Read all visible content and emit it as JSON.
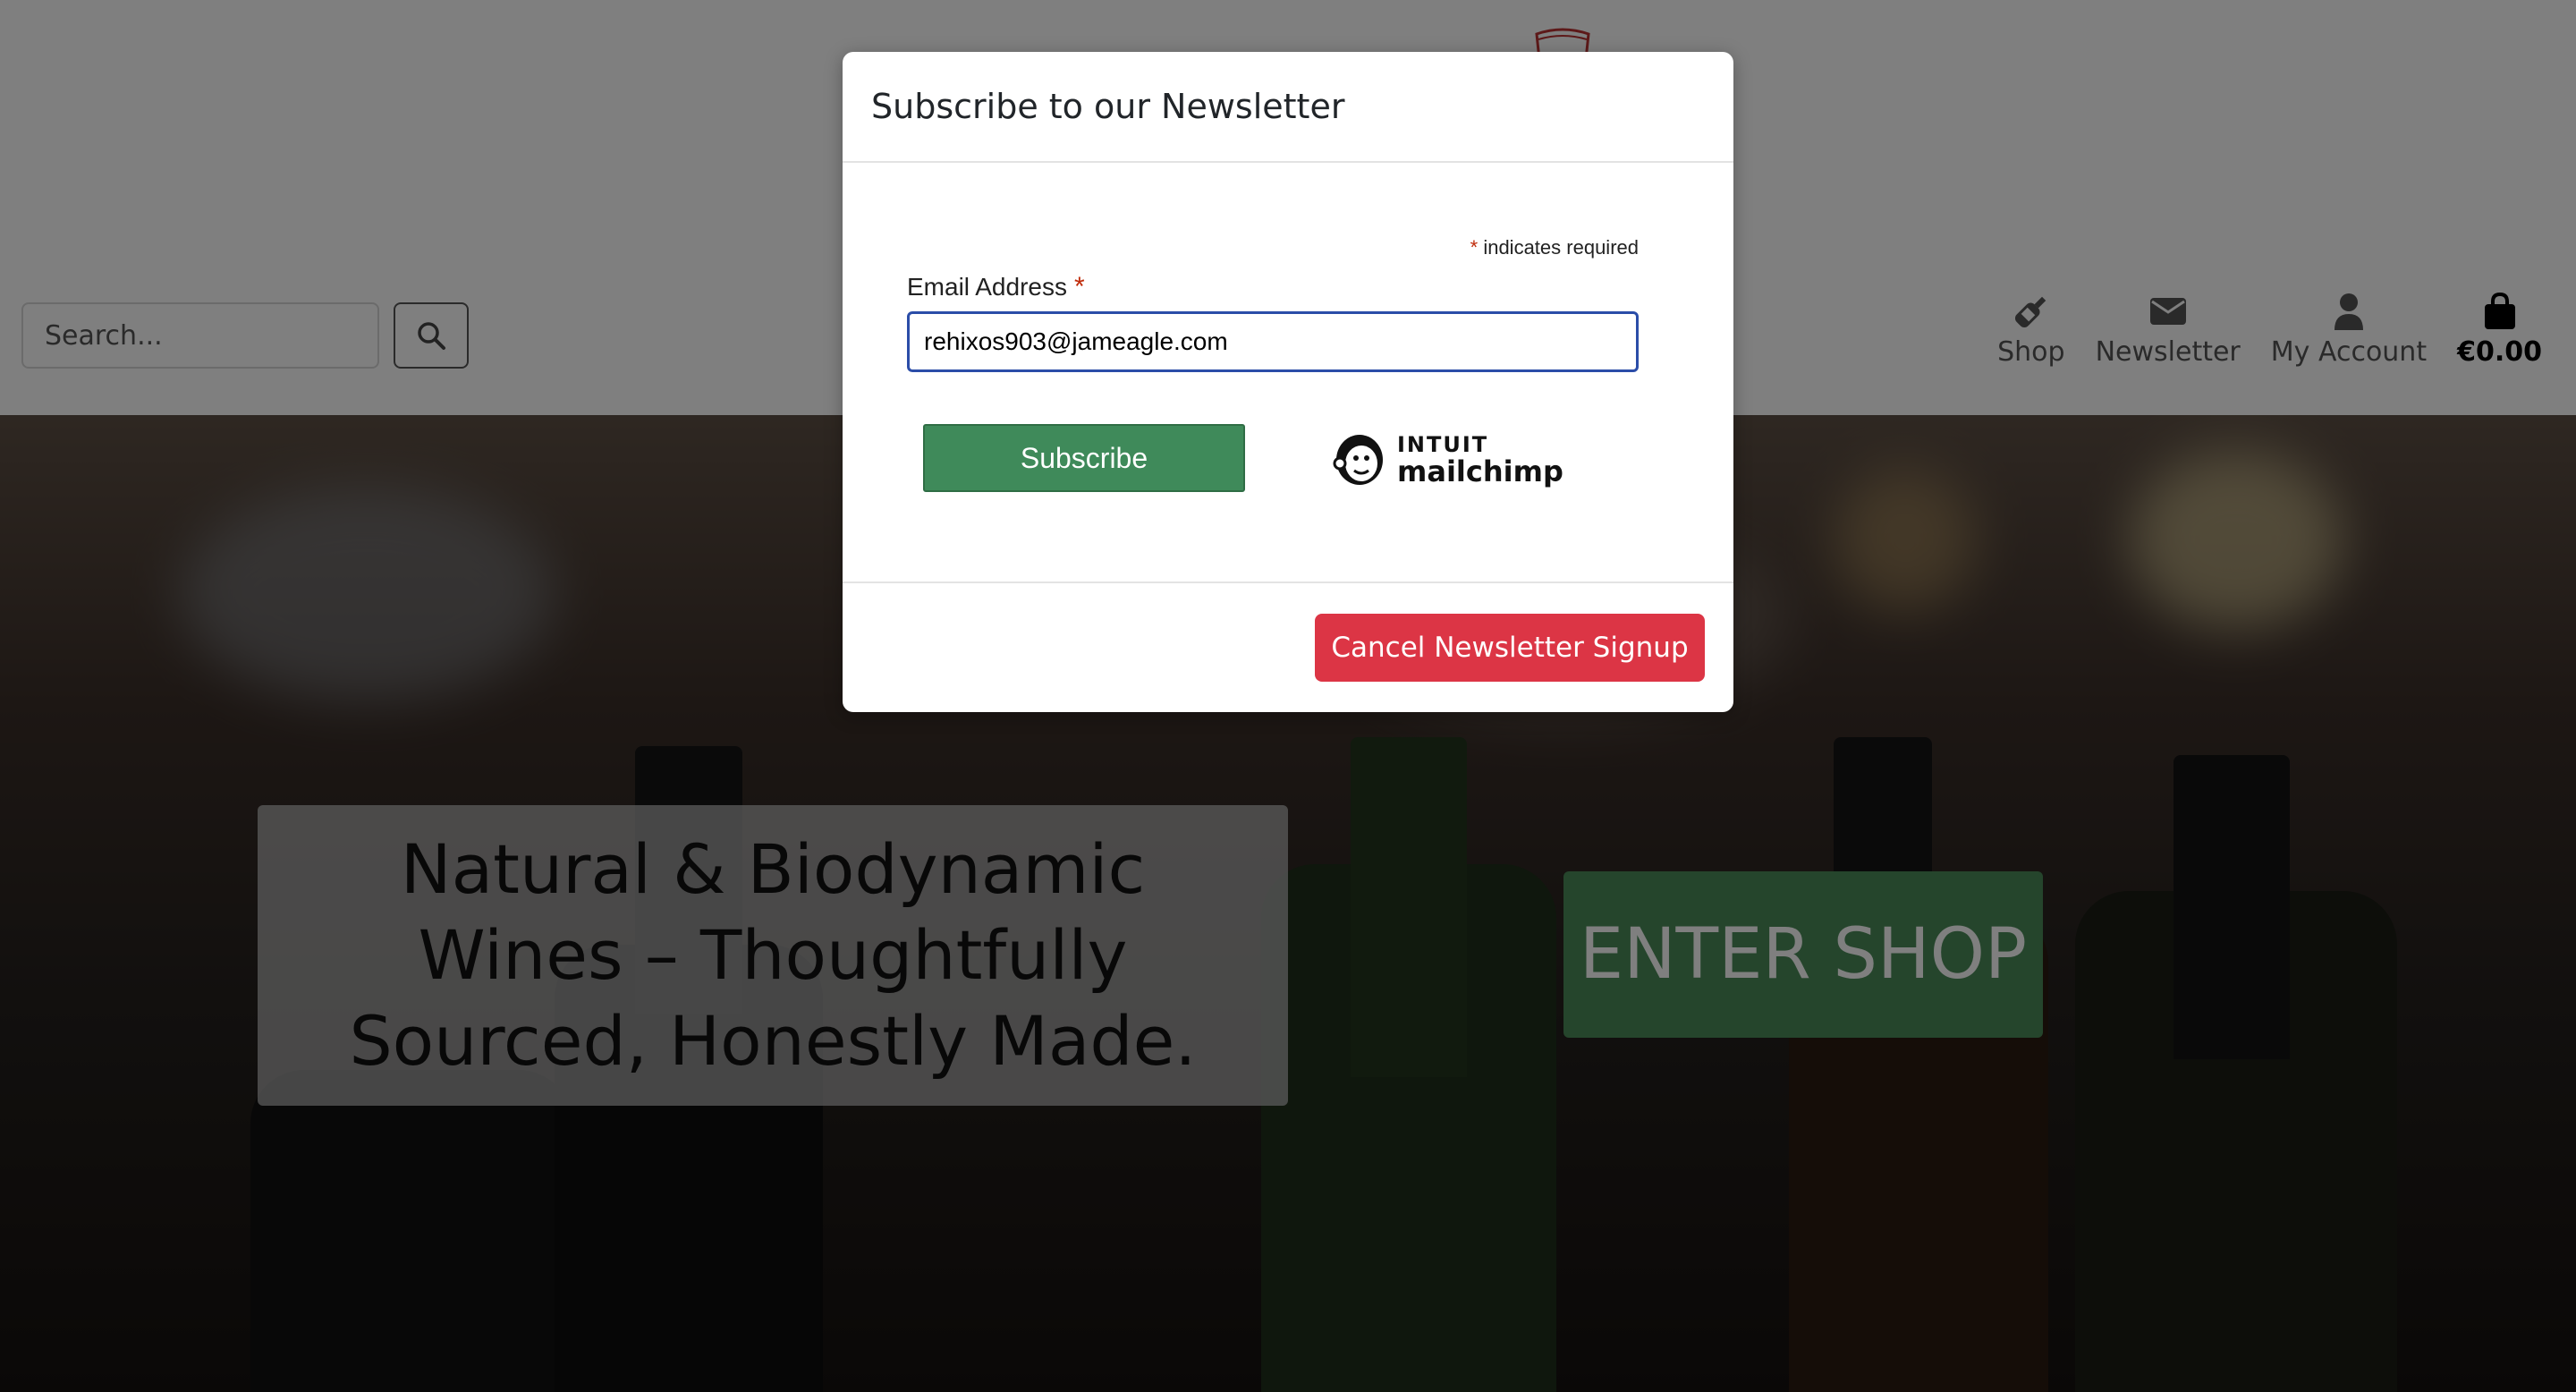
{
  "header": {
    "search_placeholder": "Search...",
    "nav": [
      {
        "label": "Shop",
        "icon": "wine-bottle-icon"
      },
      {
        "label": "Newsletter",
        "icon": "envelope-icon"
      },
      {
        "label": "My Account",
        "icon": "user-icon"
      },
      {
        "label": "€0.00",
        "icon": "shopping-bag-icon"
      }
    ]
  },
  "hero": {
    "tagline": "Natural & Biodynamic Wines – Thoughtfully Sourced, Honestly Made.",
    "enter_shop": "ENTER SHOP"
  },
  "modal": {
    "title": "Subscribe to our Newsletter",
    "required_marker": "*",
    "required_note": "indicates required",
    "email_label": "Email Address",
    "email_value": "rehixos903@jameagle.com",
    "subscribe_label": "Subscribe",
    "mailchimp_brand": "INTUIT",
    "mailchimp_name": "mailchimp",
    "cancel_label": "Cancel Newsletter Signup"
  },
  "colors": {
    "subscribe_green": "#3f8a5a",
    "cancel_red": "#dc3545",
    "enter_shop_green": "#4a8a58",
    "input_focus_blue": "#2b4da8"
  }
}
